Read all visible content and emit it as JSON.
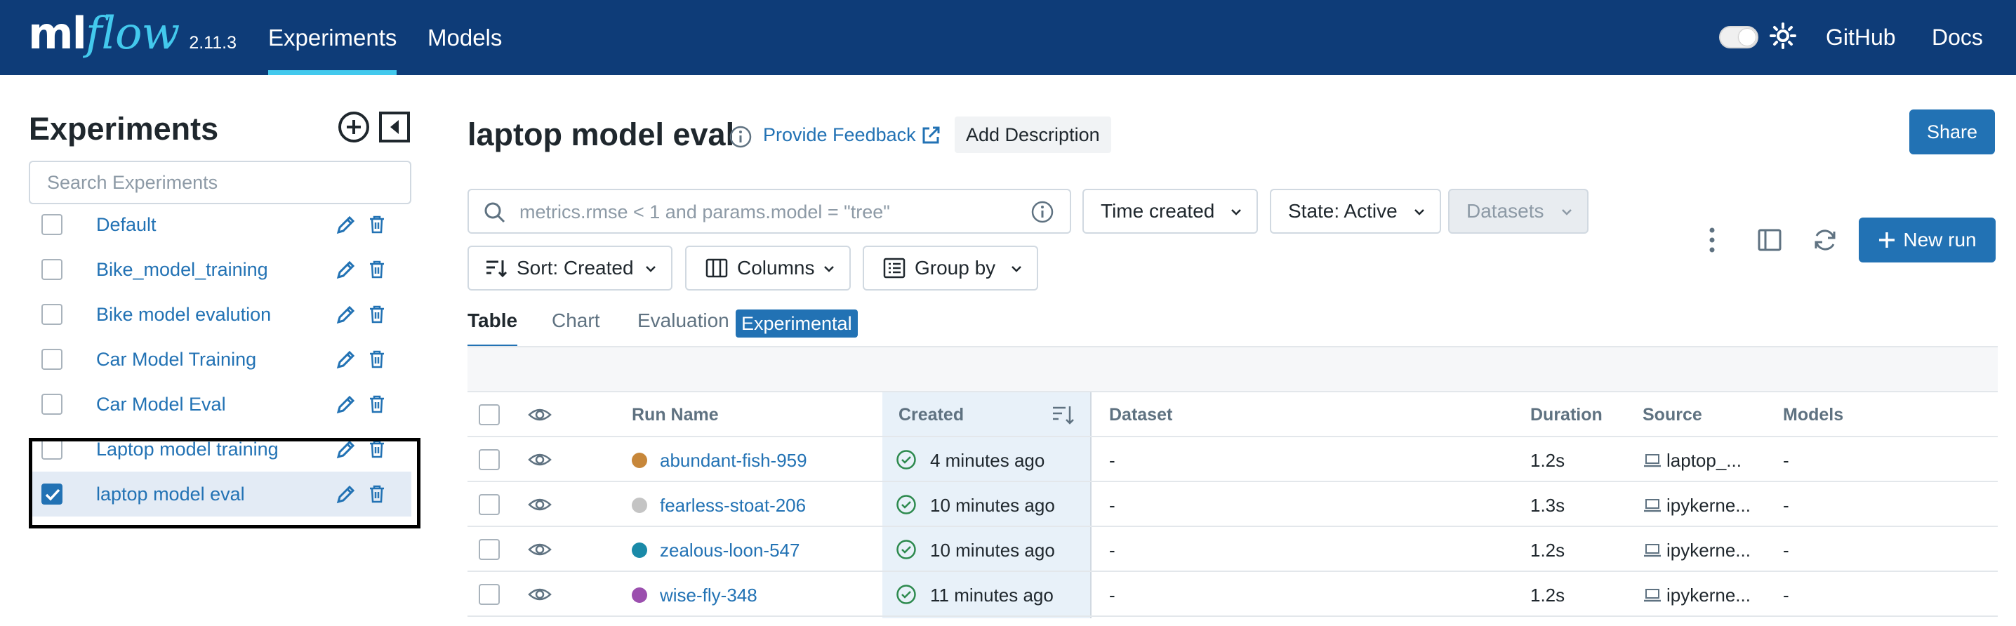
{
  "header": {
    "logo_ml": "ml",
    "logo_flow": "flow",
    "version": "2.11.3",
    "nav": [
      "Experiments",
      "Models"
    ],
    "github": "GitHub",
    "docs": "Docs"
  },
  "sidebar": {
    "title": "Experiments",
    "search_placeholder": "Search Experiments",
    "items": [
      {
        "label": "Default",
        "checked": false
      },
      {
        "label": "Bike_model_training",
        "checked": false
      },
      {
        "label": "Bike model evalution",
        "checked": false
      },
      {
        "label": "Car Model Training",
        "checked": false
      },
      {
        "label": "Car Model Eval",
        "checked": false
      },
      {
        "label": "Laptop model training",
        "checked": false
      },
      {
        "label": "laptop model eval",
        "checked": true
      }
    ]
  },
  "main": {
    "title": "laptop model eval",
    "feedback": "Provide Feedback",
    "add_description": "Add Description",
    "share": "Share",
    "search_placeholder": "metrics.rmse < 1 and params.model = \"tree\"",
    "time_created": "Time created",
    "state": "State: Active",
    "datasets": "Datasets",
    "sort": "Sort: Created",
    "columns": "Columns",
    "group_by": "Group by",
    "new_run": "New run",
    "tabs": [
      "Table",
      "Chart",
      "Evaluation"
    ],
    "badge": "Experimental"
  },
  "table": {
    "columns": [
      "Run Name",
      "Created",
      "Dataset",
      "Duration",
      "Source",
      "Models"
    ],
    "rows": [
      {
        "name": "abundant-fish-959",
        "color": "#c7873a",
        "created": "4 minutes ago",
        "dataset": "-",
        "duration": "1.2s",
        "source": "laptop_...",
        "models": "-"
      },
      {
        "name": "fearless-stoat-206",
        "color": "#c4c4c4",
        "created": "10 minutes ago",
        "dataset": "-",
        "duration": "1.3s",
        "source": "ipykerne...",
        "models": "-"
      },
      {
        "name": "zealous-loon-547",
        "color": "#1a8aa8",
        "created": "10 minutes ago",
        "dataset": "-",
        "duration": "1.2s",
        "source": "ipykerne...",
        "models": "-"
      },
      {
        "name": "wise-fly-348",
        "color": "#9b4fae",
        "created": "11 minutes ago",
        "dataset": "-",
        "duration": "1.2s",
        "source": "ipykerne...",
        "models": "-"
      }
    ]
  },
  "colors": {
    "header_bg": "#0e3c78",
    "accent": "#43c9ed",
    "primary": "#2272b4",
    "success": "#2d8a4e"
  }
}
